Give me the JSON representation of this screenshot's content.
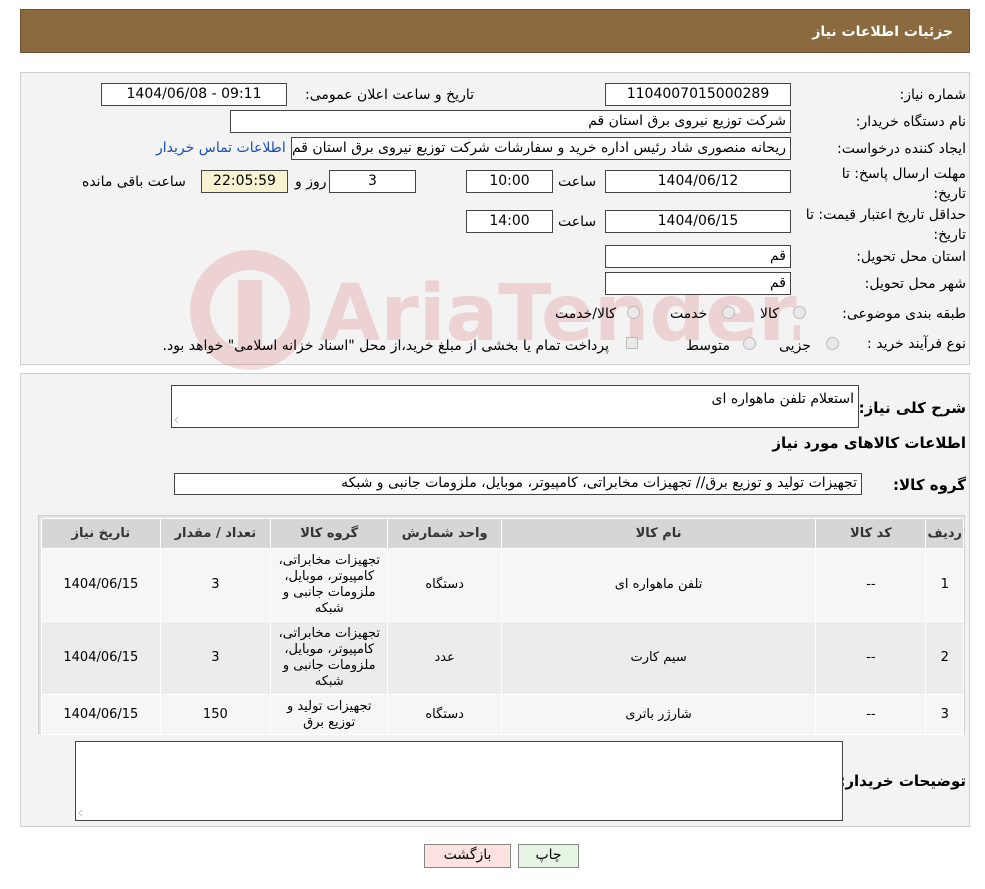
{
  "header": {
    "title": "جزئیات اطلاعات نیاز"
  },
  "form": {
    "need_number_label": "شماره نیاز:",
    "need_number": "1104007015000289",
    "announce_label": "تاریخ و ساعت اعلان عمومی:",
    "announce_value": "1404/06/08 - 09:11",
    "buyer_org_label": "نام دستگاه خریدار:",
    "buyer_org": "شرکت توزیع نیروی برق استان قم",
    "creator_label": "ایجاد کننده درخواست:",
    "creator": "ریحانه منصوری شاد رئیس اداره خرید و سفارشات شرکت توزیع نیروی برق استان قم",
    "contact_link": "اطلاعات تماس خریدار",
    "deadline_label_line1": "مهلت ارسال پاسخ: تا",
    "deadline_label_line2": "تاریخ:",
    "deadline_date": "1404/06/12",
    "time_label": "ساعت",
    "deadline_time": "10:00",
    "days_value": "3",
    "days_label": "روز و",
    "remaining_value": "22:05:59",
    "remaining_label": "ساعت باقی مانده",
    "validity_label_line1": "حداقل تاریخ اعتبار قیمت: تا",
    "validity_label_line2": "تاریخ:",
    "validity_date": "1404/06/15",
    "validity_time": "14:00",
    "province_label": "استان محل تحویل:",
    "province": "قم",
    "city_label": "شهر محل تحویل:",
    "city": "قم",
    "category_label": "طبقه بندی موضوعی:",
    "category_options": [
      "کالا",
      "خدمت",
      "کالا/خدمت"
    ],
    "process_label": "نوع فرآیند خرید :",
    "process_options": [
      "جزیی",
      "متوسط"
    ],
    "payment_note": "پرداخت تمام یا بخشی از مبلغ خرید،از محل \"اسناد خزانه اسلامی\" خواهد بود."
  },
  "watermark": {
    "text": "AriaTender.neT"
  },
  "summary": {
    "label": "شرح کلی نیاز:",
    "value": "استعلام تلفن ماهواره ای",
    "goods_info_title": "اطلاعات کالاهای مورد نیاز",
    "group_label": "گروه کالا:",
    "group_value": "تجهیزات تولید و توزیع برق// تجهیزات مخابراتی، کامپیوتر، موبایل، ملزومات جانبی و شبکه"
  },
  "table": {
    "headers": [
      "ردیف",
      "کد کالا",
      "نام کالا",
      "واحد شمارش",
      "گروه کالا",
      "تعداد / مقدار",
      "تاریخ نیاز"
    ],
    "rows": [
      [
        "1",
        "--",
        "تلفن ماهواره ای",
        "دستگاه",
        "تجهیزات مخابراتی، کامپیوتر، موبایل، ملزومات جانبی و شبکه",
        "3",
        "1404/06/15"
      ],
      [
        "2",
        "--",
        "سیم کارت",
        "عدد",
        "تجهیزات مخابراتی، کامپیوتر، موبایل، ملزومات جانبی و شبکه",
        "3",
        "1404/06/15"
      ],
      [
        "3",
        "--",
        "شارژر باتری",
        "دستگاه",
        "تجهیزات تولید و توزیع برق",
        "150",
        "1404/06/15"
      ]
    ]
  },
  "buyer_notes": {
    "label": "توضیحات خریدار:",
    "value": ""
  },
  "buttons": {
    "print": "چاپ",
    "back": "بازگشت"
  },
  "colors": {
    "header_bg": "#8b6a3f",
    "back_button_bg": "#fde2e2",
    "print_button_bg": "#e6f5e3",
    "link": "#1a4fb0"
  }
}
